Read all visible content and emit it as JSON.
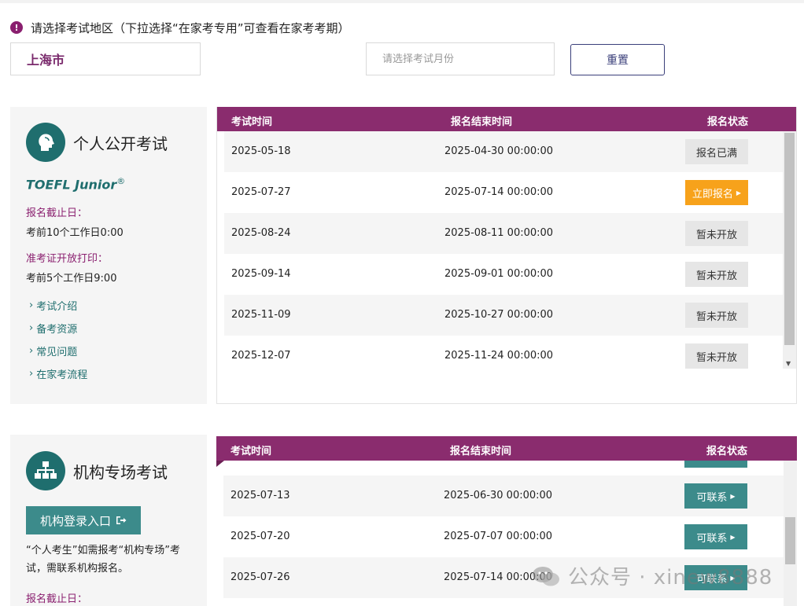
{
  "notice": "请选择考试地区（下拉选择“在家考专用”可查看在家考考期）",
  "filters": {
    "region": "上海市",
    "month_placeholder": "请选择考试月份",
    "reset_label": "重置"
  },
  "columns": [
    "考试时间",
    "报名结束时间",
    "报名状态"
  ],
  "card1": {
    "title": "个人公开考试",
    "brand": "TOEFL Junior",
    "brand_mark": "®",
    "deadline_label": "报名截止日：",
    "deadline_value": "考前10个工作日0:00",
    "print_label": "准考证开放打印：",
    "print_value": "考前5个工作日9:00",
    "links": [
      "考试介绍",
      "备考资源",
      "常见问题",
      "在家考流程"
    ]
  },
  "table1": [
    {
      "date": "2025-05-18",
      "end": "2025-04-30 00:00:00",
      "status": "报名已满",
      "style": "gray"
    },
    {
      "date": "2025-07-27",
      "end": "2025-07-14 00:00:00",
      "status": "立即报名",
      "style": "orange"
    },
    {
      "date": "2025-08-24",
      "end": "2025-08-11 00:00:00",
      "status": "暂未开放",
      "style": "gray"
    },
    {
      "date": "2025-09-14",
      "end": "2025-09-01 00:00:00",
      "status": "暂未开放",
      "style": "gray"
    },
    {
      "date": "2025-11-09",
      "end": "2025-10-27 00:00:00",
      "status": "暂未开放",
      "style": "gray"
    },
    {
      "date": "2025-12-07",
      "end": "2025-11-24 00:00:00",
      "status": "暂未开放",
      "style": "gray"
    }
  ],
  "card2": {
    "title": "机构专场考试",
    "login_label": "机构登录入口",
    "note": "“个人考生”如需报考“机构专场”考试，需联系机构报名。",
    "deadline_label": "报名截止日："
  },
  "table2": [
    {
      "date": "2025-07-13",
      "end": "2025-06-30 00:00:00",
      "status": "可联系",
      "style": "teal"
    },
    {
      "date": "2025-07-20",
      "end": "2025-07-07 00:00:00",
      "status": "可联系",
      "style": "teal"
    },
    {
      "date": "2025-07-26",
      "end": "2025-07-14 00:00:00",
      "status": "可联系",
      "style": "teal"
    }
  ],
  "watermark": "公众号 · xinew8888",
  "colors": {
    "brand_purple": "#8a2c6e",
    "teal": "#3c8b8b",
    "orange": "#f7a21b"
  }
}
